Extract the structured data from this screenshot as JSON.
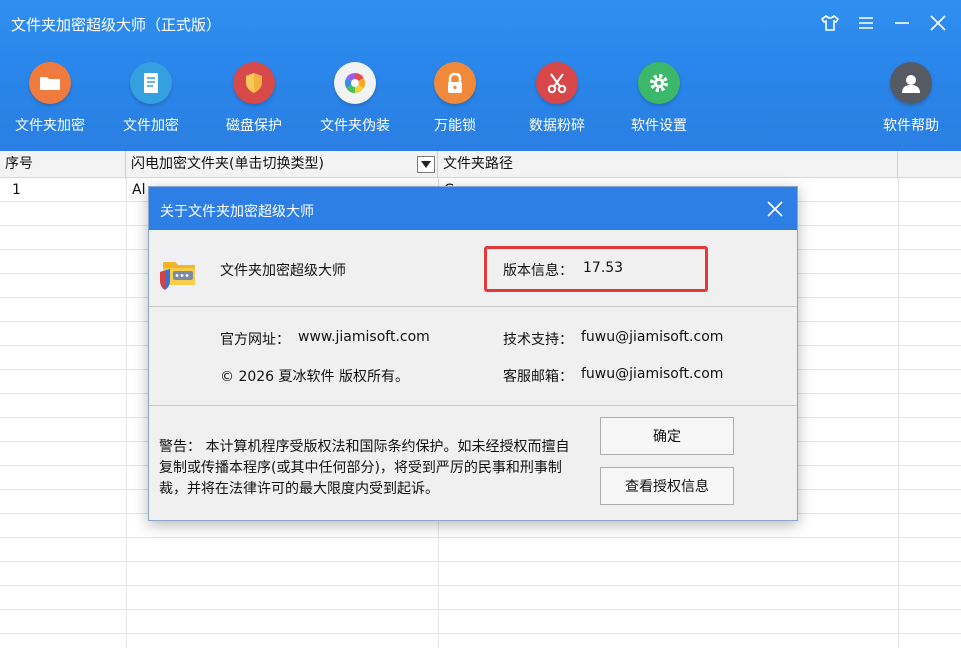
{
  "window": {
    "title": "文件夹加密超级大师（正式版）"
  },
  "toolbar": {
    "items": [
      {
        "label": "文件夹加密",
        "icon": "folder-icon",
        "color": "#f07b3f"
      },
      {
        "label": "文件加密",
        "icon": "document-icon",
        "color": "#35a0e0"
      },
      {
        "label": "磁盘保护",
        "icon": "shield-icon",
        "color": "#d84a4a"
      },
      {
        "label": "文件夹伪装",
        "icon": "color-wheel-icon",
        "color": "#f2f2f2"
      },
      {
        "label": "万能锁",
        "icon": "lock-icon",
        "color": "#f08a3a"
      },
      {
        "label": "数据粉碎",
        "icon": "scissors-icon",
        "color": "#d94848"
      },
      {
        "label": "软件设置",
        "icon": "gear-icon",
        "color": "#3cb86a"
      },
      {
        "label": "软件帮助",
        "icon": "user-icon",
        "color": "#555a63"
      }
    ]
  },
  "table": {
    "columns": [
      "序号",
      "闪电加密文件夹(单击切换类型)",
      "文件夹路径"
    ],
    "rows": [
      {
        "index": "1",
        "name": "Al",
        "path": "C"
      }
    ]
  },
  "dialog": {
    "title": "关于文件夹加密超级大师",
    "product_name": "文件夹加密超级大师",
    "version_label": "版本信息：",
    "version_value": "17.53",
    "website_label": "官方网址：",
    "website_value": "www.jiamisoft.com",
    "support_label": "技术支持：",
    "support_value": "fuwu@jiamisoft.com",
    "copyright": "© 2026 夏冰软件 版权所有。",
    "service_label": "客服邮箱：",
    "service_value": "fuwu@jiamisoft.com",
    "warning": "警告： 本计算机程序受版权法和国际条约保护。如未经授权而擅自复制或传播本程序(或其中任何部分)，将受到严厉的民事和刑事制裁，并将在法律许可的最大限度内受到起诉。",
    "ok_button": "确定",
    "license_button": "查看授权信息"
  },
  "colors": {
    "header_blue": "#2a86ea",
    "dialog_title_blue": "#2d7fe6",
    "highlight_red": "#e23a3a"
  }
}
